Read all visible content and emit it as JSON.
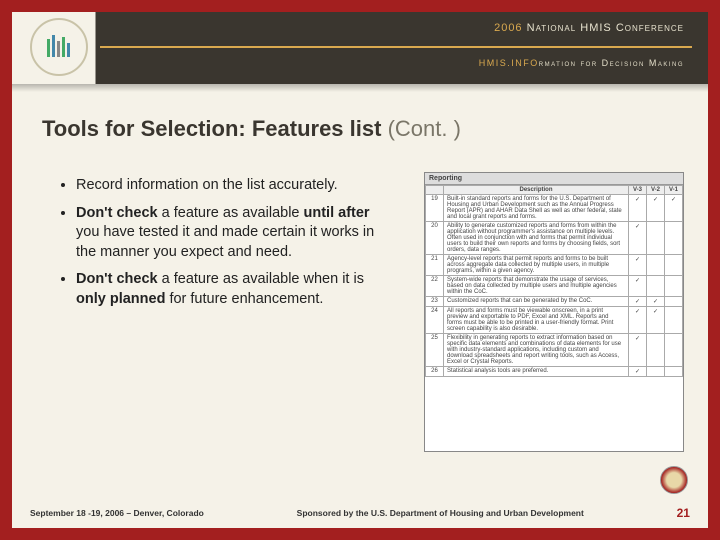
{
  "header": {
    "year": "2006",
    "conference": "National HMIS Conference",
    "tagline_accent": "HMIS.INFO",
    "tagline_rest": "rmation for Decision Making"
  },
  "slide": {
    "title_main": "Tools for Selection: Features list",
    "title_cont": "(Cont. )"
  },
  "bullets": [
    {
      "pre": "",
      "b1": "",
      "mid": "Record information on the list accurately.",
      "b2": "",
      "post": ""
    },
    {
      "pre": "",
      "b1": "Don't check",
      "mid": " a feature as available ",
      "b2": "until after",
      "post": " you have tested it and made certain it works in the manner you expect and need."
    },
    {
      "pre": "",
      "b1": "Don't check",
      "mid": " a feature as available when it is ",
      "b2": "only planned",
      "post": " for future enhancement."
    }
  ],
  "table": {
    "section": "Reporting",
    "head_desc": "Description",
    "head_v3": "V-3",
    "head_v2": "V-2",
    "head_v1": "V-1",
    "rows": [
      {
        "n": "19",
        "d": "Built-in standard reports and forms for the U.S. Department of Housing and Urban Development such as the Annual Progress Report (APR) and AHAR Data Shell as well as other federal, state and local grant reports and forms.",
        "c3": "✓",
        "c2": "✓",
        "c1": "✓"
      },
      {
        "n": "20",
        "d": "Ability to generate customized reports and forms from within the application without programmer's assistance on multiple levels. Often used in conjunction with and forms that permit individual users to build their own reports and forms by choosing fields, sort orders, data ranges.",
        "c3": "✓",
        "c2": "",
        "c1": ""
      },
      {
        "n": "21",
        "d": "Agency-level reports that permit reports and forms to be built across aggregate data collected by multiple users, in multiple programs, within a given agency.",
        "c3": "✓",
        "c2": "",
        "c1": ""
      },
      {
        "n": "22",
        "d": "System-wide reports that demonstrate the usage of services, based on data collected by multiple users and multiple agencies within the CoC.",
        "c3": "✓",
        "c2": "",
        "c1": ""
      },
      {
        "n": "23",
        "d": "Customized reports that can be generated by the CoC.",
        "c3": "✓",
        "c2": "✓",
        "c1": ""
      },
      {
        "n": "24",
        "d": "All reports and forms must be viewable onscreen, in a print preview and exportable to PDF, Excel and XML. Reports and forms must be able to be printed in a user-friendly format. Print screen capability is also desirable.",
        "c3": "✓",
        "c2": "✓",
        "c1": ""
      },
      {
        "n": "25",
        "d": "Flexibility in generating reports to extract information based on specific data elements and combinations of data elements for use with industry-standard applications, including custom and download spreadsheets and report writing tools, such as Access, Excel or Crystal Reports.",
        "c3": "✓",
        "c2": "",
        "c1": ""
      },
      {
        "n": "26",
        "d": "Statistical analysis tools are preferred.",
        "c3": "✓",
        "c2": "",
        "c1": ""
      }
    ]
  },
  "footer": {
    "left": "September 18 -19, 2006 – Denver, Colorado",
    "mid": "Sponsored by the U.S. Department of Housing and Urban Development",
    "page": "21"
  }
}
